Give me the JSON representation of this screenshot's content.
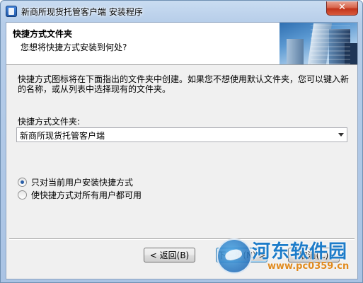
{
  "window": {
    "title": "新商所现货托管客户端 安装程序",
    "close_label": "✕"
  },
  "header": {
    "title": "快捷方式文件夹",
    "subtitle": "您想将快捷方式安装到何处?"
  },
  "body": {
    "description": "快捷方式图标将在下面指出的文件夹中创建。如果您不想使用默认文件夹，您可以键入新的名称，或从列表中选择现有的文件夹。",
    "folder_label": "快捷方式文件夹:",
    "folder_value": "新商所现货托管客户端"
  },
  "options": [
    {
      "label": "只对当前用户安装快捷方式",
      "selected": true
    },
    {
      "label": "使快捷方式对所有用户都可用",
      "selected": false
    }
  ],
  "buttons": {
    "back": "< 返回(B)",
    "next": "下一步(N) >",
    "cancel": "取消(C)"
  },
  "watermark": {
    "name": "河东软件园",
    "url": "www.pc0359.cn"
  }
}
